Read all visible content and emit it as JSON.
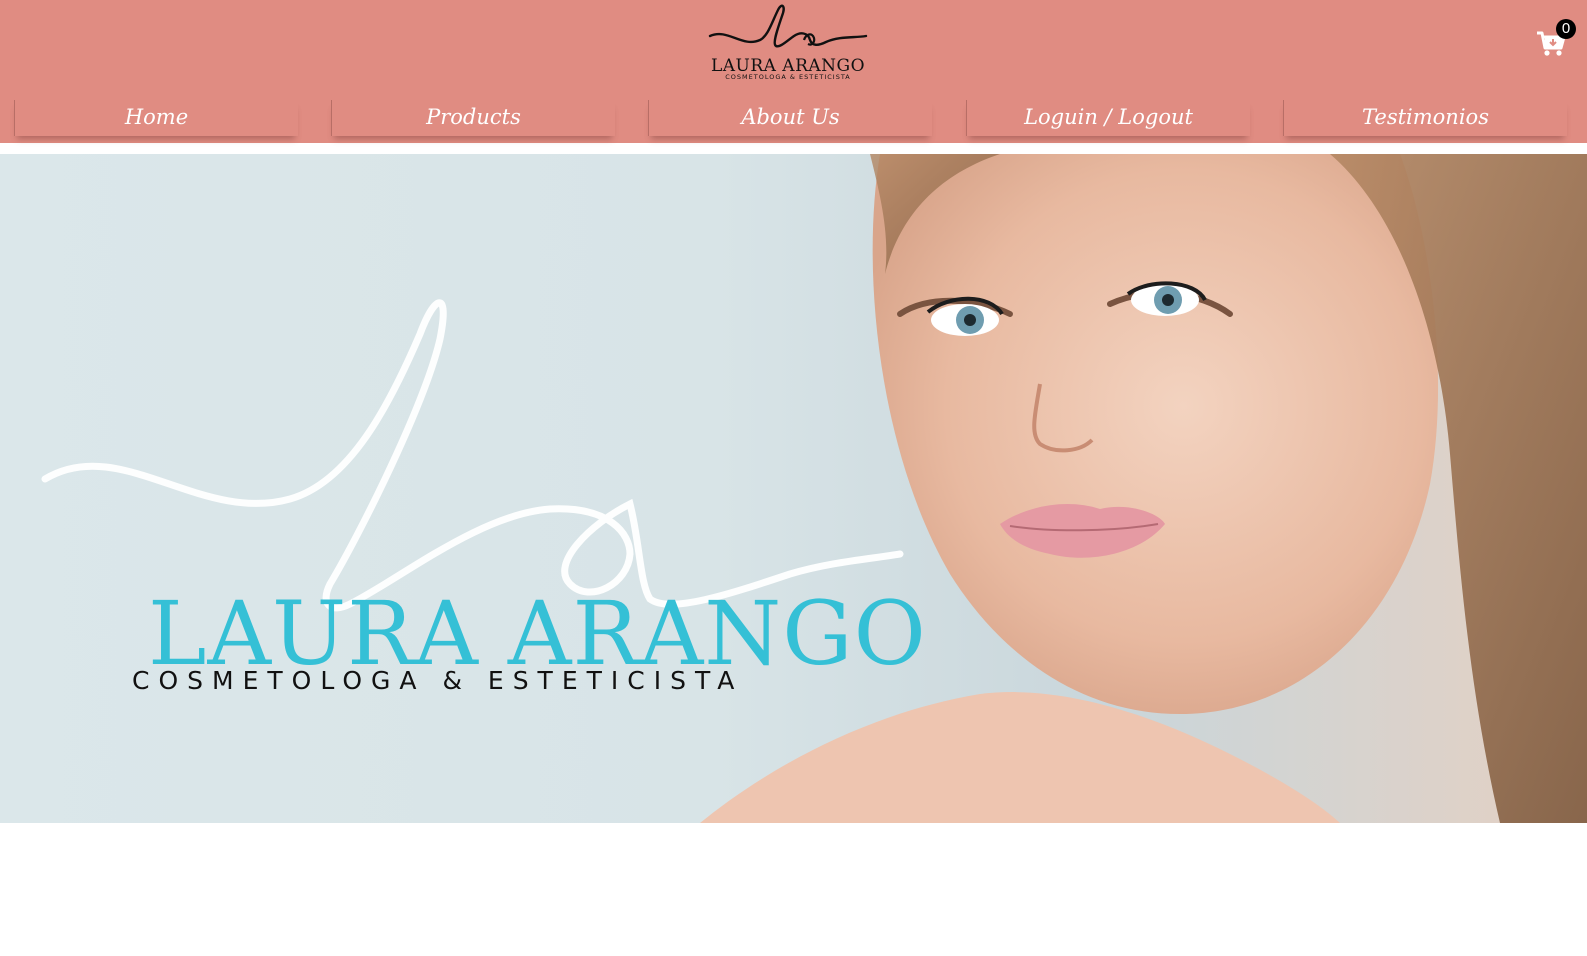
{
  "header": {
    "background": "#e08c82",
    "logo": {
      "name": "LAURA ARANGO",
      "subtitle": "COSMETOLOGA & ESTETICISTA"
    },
    "cart": {
      "icon": "cart-icon",
      "count": "0"
    }
  },
  "nav": {
    "items": [
      {
        "label": "Home"
      },
      {
        "label": "Products"
      },
      {
        "label": "About Us"
      },
      {
        "label": "Loguin / Logout"
      },
      {
        "label": "Testimonios"
      }
    ]
  },
  "hero": {
    "name": "LAURA ARANGO",
    "subtitle": "COSMETOLOGA & ESTETICISTA",
    "name_color": "#35c0d6"
  }
}
